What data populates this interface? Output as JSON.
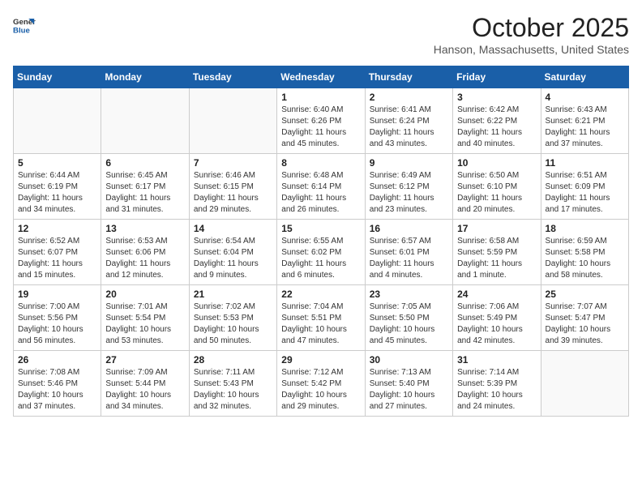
{
  "header": {
    "logo_line1": "General",
    "logo_line2": "Blue",
    "month_title": "October 2025",
    "location": "Hanson, Massachusetts, United States"
  },
  "days_of_week": [
    "Sunday",
    "Monday",
    "Tuesday",
    "Wednesday",
    "Thursday",
    "Friday",
    "Saturday"
  ],
  "weeks": [
    [
      {
        "day": "",
        "info": ""
      },
      {
        "day": "",
        "info": ""
      },
      {
        "day": "",
        "info": ""
      },
      {
        "day": "1",
        "info": "Sunrise: 6:40 AM\nSunset: 6:26 PM\nDaylight: 11 hours\nand 45 minutes."
      },
      {
        "day": "2",
        "info": "Sunrise: 6:41 AM\nSunset: 6:24 PM\nDaylight: 11 hours\nand 43 minutes."
      },
      {
        "day": "3",
        "info": "Sunrise: 6:42 AM\nSunset: 6:22 PM\nDaylight: 11 hours\nand 40 minutes."
      },
      {
        "day": "4",
        "info": "Sunrise: 6:43 AM\nSunset: 6:21 PM\nDaylight: 11 hours\nand 37 minutes."
      }
    ],
    [
      {
        "day": "5",
        "info": "Sunrise: 6:44 AM\nSunset: 6:19 PM\nDaylight: 11 hours\nand 34 minutes."
      },
      {
        "day": "6",
        "info": "Sunrise: 6:45 AM\nSunset: 6:17 PM\nDaylight: 11 hours\nand 31 minutes."
      },
      {
        "day": "7",
        "info": "Sunrise: 6:46 AM\nSunset: 6:15 PM\nDaylight: 11 hours\nand 29 minutes."
      },
      {
        "day": "8",
        "info": "Sunrise: 6:48 AM\nSunset: 6:14 PM\nDaylight: 11 hours\nand 26 minutes."
      },
      {
        "day": "9",
        "info": "Sunrise: 6:49 AM\nSunset: 6:12 PM\nDaylight: 11 hours\nand 23 minutes."
      },
      {
        "day": "10",
        "info": "Sunrise: 6:50 AM\nSunset: 6:10 PM\nDaylight: 11 hours\nand 20 minutes."
      },
      {
        "day": "11",
        "info": "Sunrise: 6:51 AM\nSunset: 6:09 PM\nDaylight: 11 hours\nand 17 minutes."
      }
    ],
    [
      {
        "day": "12",
        "info": "Sunrise: 6:52 AM\nSunset: 6:07 PM\nDaylight: 11 hours\nand 15 minutes."
      },
      {
        "day": "13",
        "info": "Sunrise: 6:53 AM\nSunset: 6:06 PM\nDaylight: 11 hours\nand 12 minutes."
      },
      {
        "day": "14",
        "info": "Sunrise: 6:54 AM\nSunset: 6:04 PM\nDaylight: 11 hours\nand 9 minutes."
      },
      {
        "day": "15",
        "info": "Sunrise: 6:55 AM\nSunset: 6:02 PM\nDaylight: 11 hours\nand 6 minutes."
      },
      {
        "day": "16",
        "info": "Sunrise: 6:57 AM\nSunset: 6:01 PM\nDaylight: 11 hours\nand 4 minutes."
      },
      {
        "day": "17",
        "info": "Sunrise: 6:58 AM\nSunset: 5:59 PM\nDaylight: 11 hours\nand 1 minute."
      },
      {
        "day": "18",
        "info": "Sunrise: 6:59 AM\nSunset: 5:58 PM\nDaylight: 10 hours\nand 58 minutes."
      }
    ],
    [
      {
        "day": "19",
        "info": "Sunrise: 7:00 AM\nSunset: 5:56 PM\nDaylight: 10 hours\nand 56 minutes."
      },
      {
        "day": "20",
        "info": "Sunrise: 7:01 AM\nSunset: 5:54 PM\nDaylight: 10 hours\nand 53 minutes."
      },
      {
        "day": "21",
        "info": "Sunrise: 7:02 AM\nSunset: 5:53 PM\nDaylight: 10 hours\nand 50 minutes."
      },
      {
        "day": "22",
        "info": "Sunrise: 7:04 AM\nSunset: 5:51 PM\nDaylight: 10 hours\nand 47 minutes."
      },
      {
        "day": "23",
        "info": "Sunrise: 7:05 AM\nSunset: 5:50 PM\nDaylight: 10 hours\nand 45 minutes."
      },
      {
        "day": "24",
        "info": "Sunrise: 7:06 AM\nSunset: 5:49 PM\nDaylight: 10 hours\nand 42 minutes."
      },
      {
        "day": "25",
        "info": "Sunrise: 7:07 AM\nSunset: 5:47 PM\nDaylight: 10 hours\nand 39 minutes."
      }
    ],
    [
      {
        "day": "26",
        "info": "Sunrise: 7:08 AM\nSunset: 5:46 PM\nDaylight: 10 hours\nand 37 minutes."
      },
      {
        "day": "27",
        "info": "Sunrise: 7:09 AM\nSunset: 5:44 PM\nDaylight: 10 hours\nand 34 minutes."
      },
      {
        "day": "28",
        "info": "Sunrise: 7:11 AM\nSunset: 5:43 PM\nDaylight: 10 hours\nand 32 minutes."
      },
      {
        "day": "29",
        "info": "Sunrise: 7:12 AM\nSunset: 5:42 PM\nDaylight: 10 hours\nand 29 minutes."
      },
      {
        "day": "30",
        "info": "Sunrise: 7:13 AM\nSunset: 5:40 PM\nDaylight: 10 hours\nand 27 minutes."
      },
      {
        "day": "31",
        "info": "Sunrise: 7:14 AM\nSunset: 5:39 PM\nDaylight: 10 hours\nand 24 minutes."
      },
      {
        "day": "",
        "info": ""
      }
    ]
  ]
}
